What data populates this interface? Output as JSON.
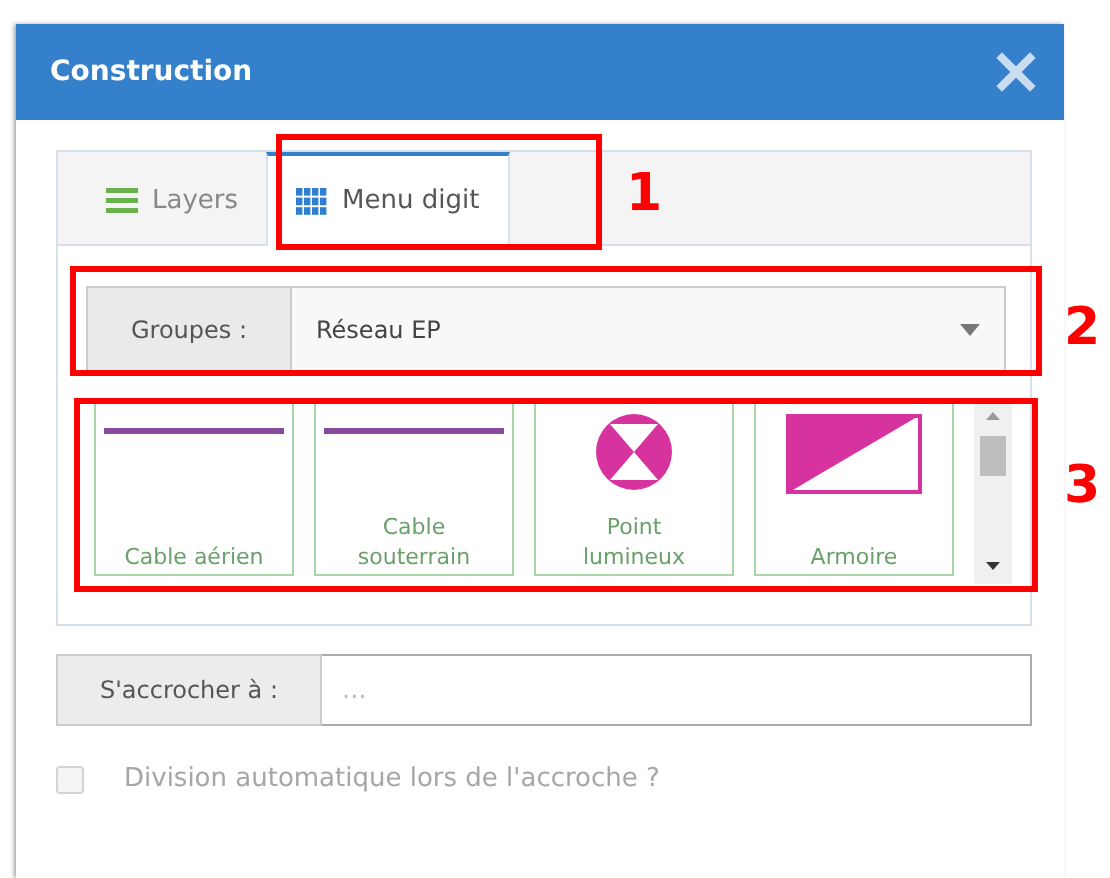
{
  "window": {
    "title": "Construction"
  },
  "tabs": [
    {
      "label": "Layers",
      "kind": "list",
      "selected": false
    },
    {
      "label": "Menu digit",
      "kind": "grid",
      "selected": true
    }
  ],
  "group_select": {
    "label": "Groupes :",
    "value": "Réseau EP"
  },
  "palette": [
    {
      "label": "Cable aérien",
      "kind": "line",
      "color": "#8a4a9c"
    },
    {
      "label": "Cable souterrain",
      "kind": "line",
      "color": "#8a4a9c"
    },
    {
      "label": "Point lumineux",
      "kind": "lamp",
      "color": "#d6339e"
    },
    {
      "label": "Armoire",
      "kind": "cabinet",
      "color": "#d6339e"
    }
  ],
  "snap_field": {
    "label": "S'accrocher à :",
    "placeholder": "..."
  },
  "auto_split": {
    "label": "Division automatique lors de l'accroche ?",
    "checked": false,
    "disabled": true
  },
  "annotations": [
    {
      "label": "1"
    },
    {
      "label": "2"
    },
    {
      "label": "3"
    }
  ]
}
